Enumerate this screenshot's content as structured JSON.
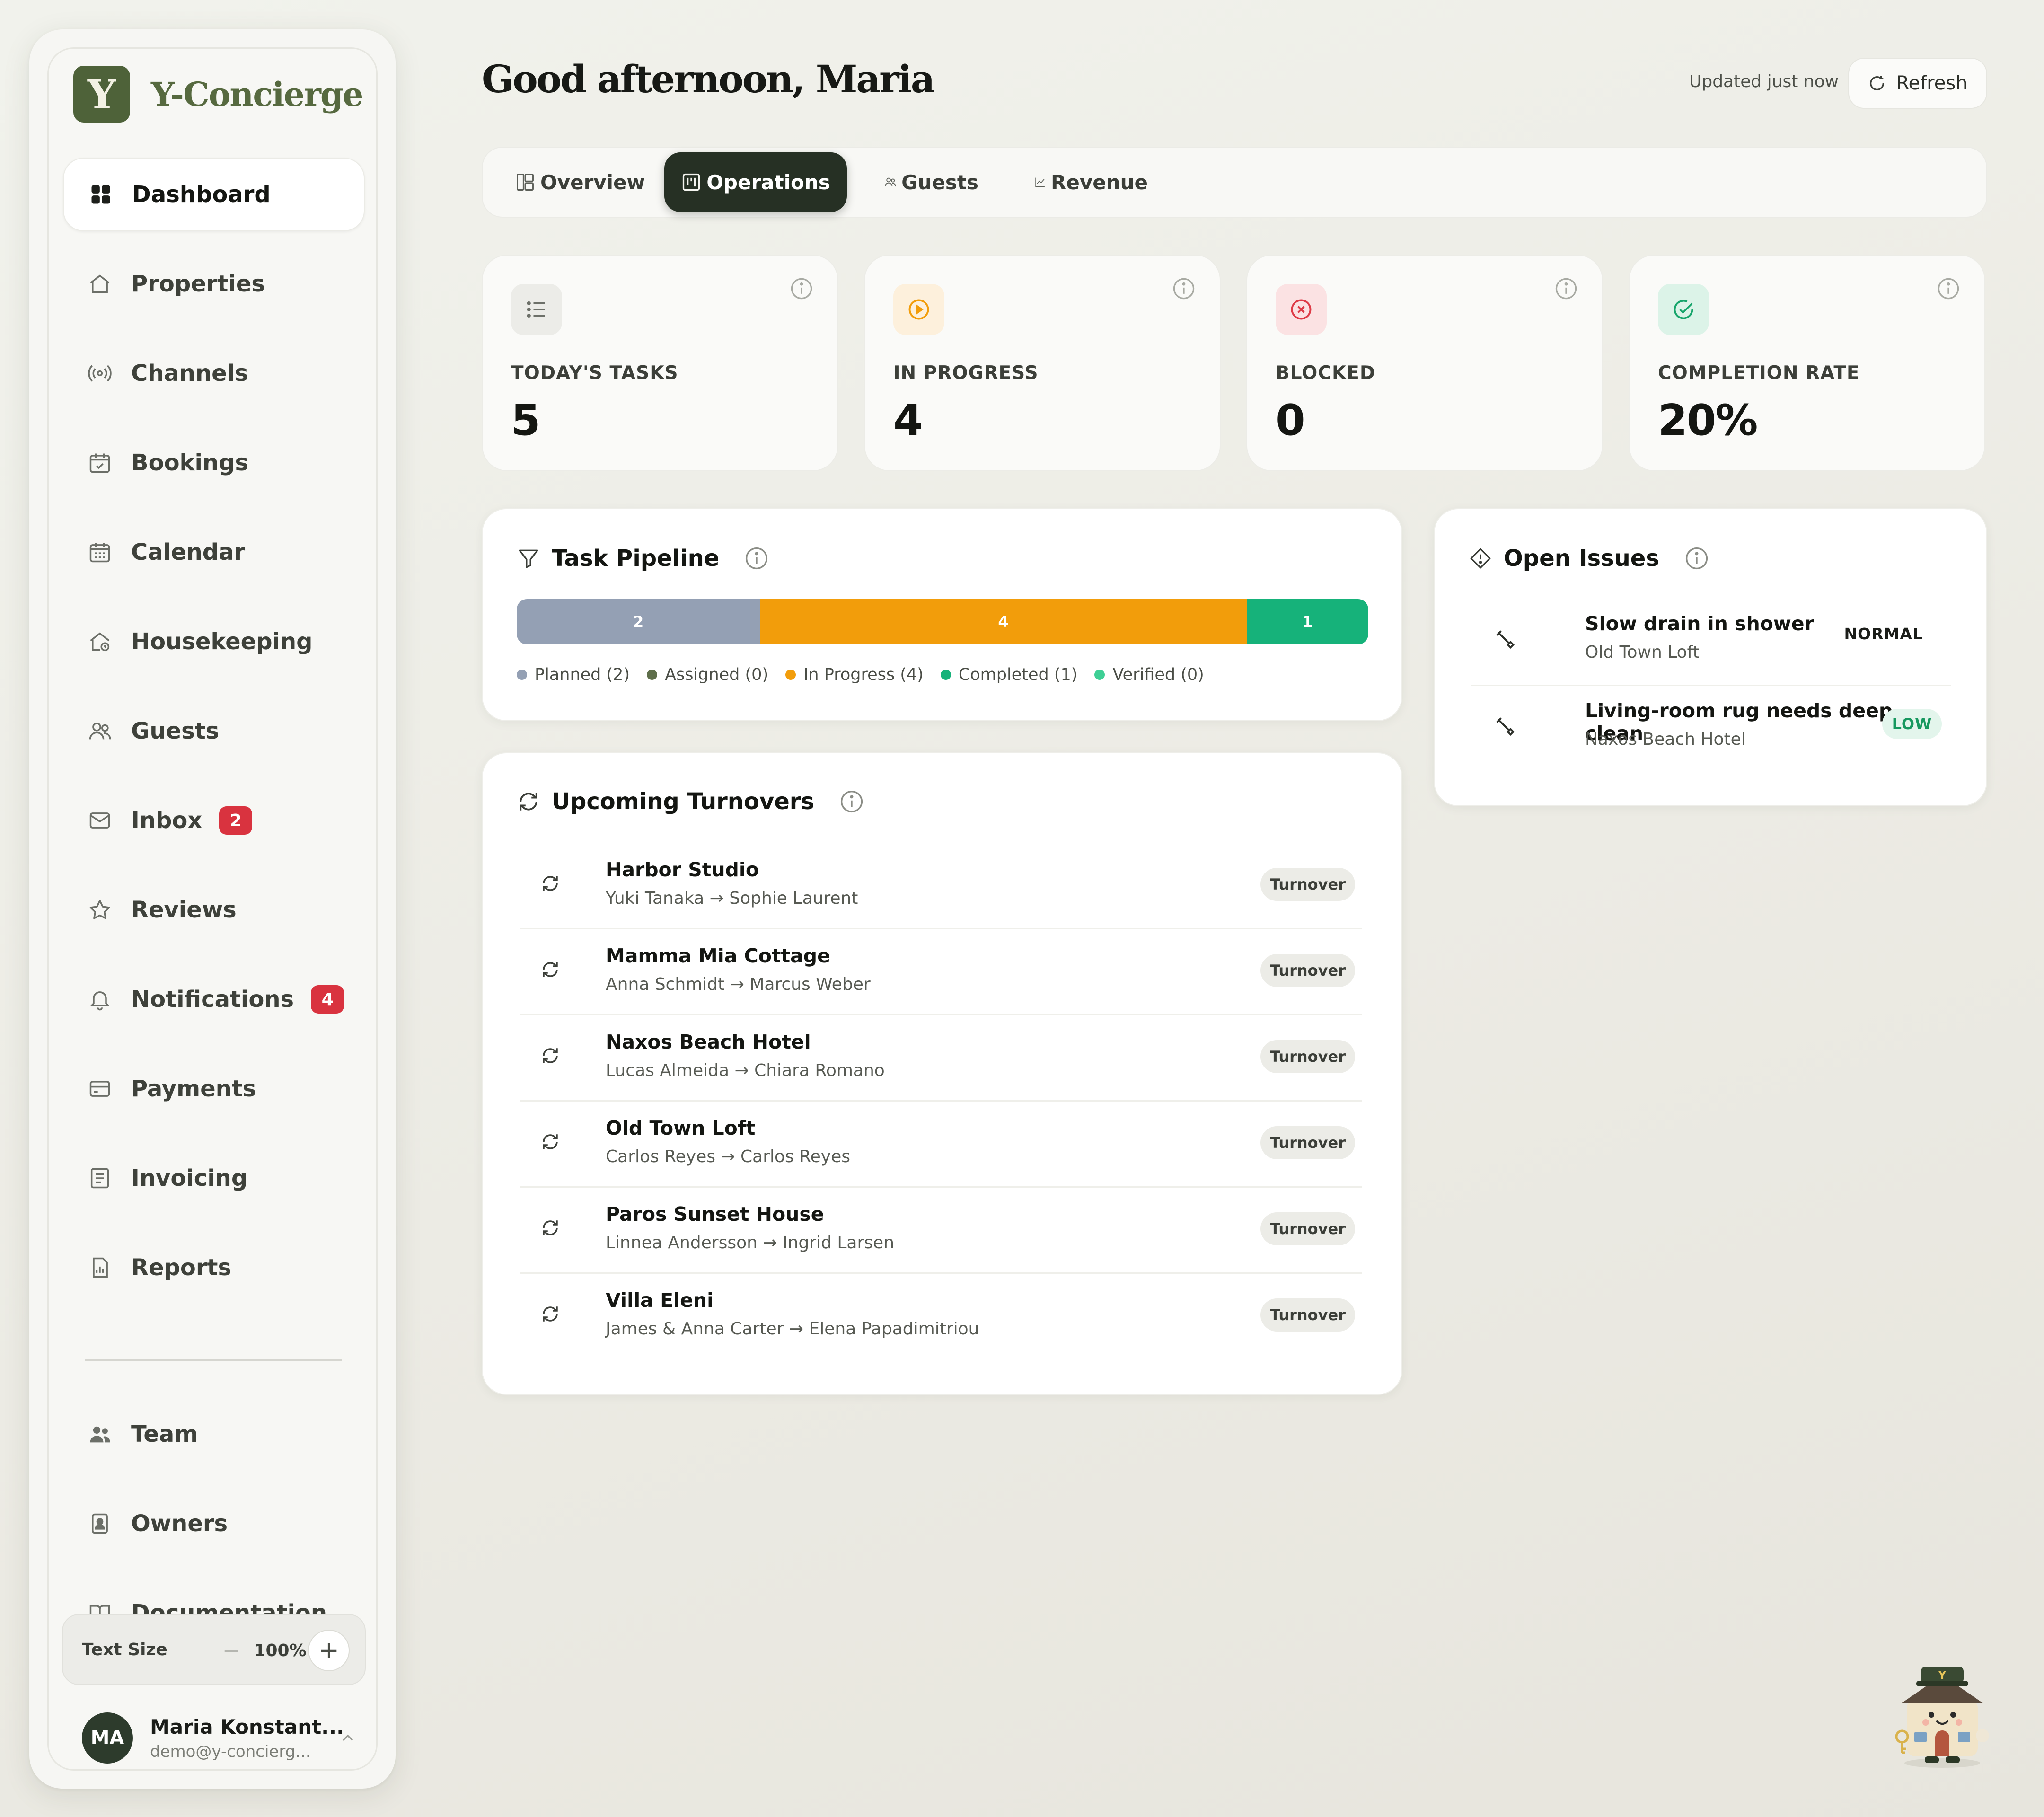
{
  "brand": {
    "logo_letter": "Y",
    "name": "Y-Concierge",
    "color": "#56693f"
  },
  "sidebar": {
    "items": [
      {
        "label": "Dashboard",
        "icon": "dashboard-icon",
        "active": true
      },
      {
        "label": "Properties",
        "icon": "home-icon"
      },
      {
        "label": "Channels",
        "icon": "broadcast-icon"
      },
      {
        "label": "Bookings",
        "icon": "calendar-check-icon"
      },
      {
        "label": "Calendar",
        "icon": "calendar-icon"
      },
      {
        "label": "Housekeeping",
        "icon": "house-clean-icon"
      },
      {
        "label": "Guests",
        "icon": "users-icon"
      },
      {
        "label": "Inbox",
        "icon": "mail-icon",
        "badge": "2"
      },
      {
        "label": "Reviews",
        "icon": "star-icon"
      },
      {
        "label": "Notifications",
        "icon": "bell-icon",
        "badge": "4"
      },
      {
        "label": "Payments",
        "icon": "credit-card-icon"
      },
      {
        "label": "Invoicing",
        "icon": "receipt-icon"
      },
      {
        "label": "Reports",
        "icon": "report-icon"
      }
    ],
    "secondary": [
      {
        "label": "Team",
        "icon": "team-icon"
      },
      {
        "label": "Owners",
        "icon": "owner-badge-icon"
      },
      {
        "label": "Documentation",
        "icon": "book-icon"
      }
    ],
    "text_size": {
      "label": "Text Size",
      "minus": "−",
      "value": "100%",
      "plus": "+"
    },
    "profile": {
      "initials": "MA",
      "name": "Maria Konstant...",
      "email": "demo@y-concierg..."
    }
  },
  "header": {
    "greeting": "Good afternoon, Maria",
    "updated": "Updated just now",
    "refresh_label": "Refresh"
  },
  "tabs": [
    {
      "label": "Overview",
      "icon": "layout-icon"
    },
    {
      "label": "Operations",
      "icon": "kanban-icon",
      "active": true
    },
    {
      "label": "Guests",
      "icon": "users-icon"
    },
    {
      "label": "Revenue",
      "icon": "line-chart-icon"
    }
  ],
  "stats": [
    {
      "label": "TODAY'S TASKS",
      "value": "5",
      "icon": "list-icon",
      "color": "#6d7069"
    },
    {
      "label": "IN PROGRESS",
      "value": "4",
      "icon": "play-circle-icon",
      "color": "#f29d0b"
    },
    {
      "label": "BLOCKED",
      "value": "0",
      "icon": "x-circle-icon",
      "color": "#de3b47"
    },
    {
      "label": "COMPLETION RATE",
      "value": "20%",
      "icon": "check-circle-icon",
      "color": "#17a56b"
    }
  ],
  "pipeline": {
    "title": "Task Pipeline",
    "segments": [
      {
        "label": "2",
        "value": 2,
        "color": "#94a0b4"
      },
      {
        "label": "4",
        "value": 4,
        "color": "#f29d0b"
      },
      {
        "label": "1",
        "value": 1,
        "color": "#16b27a"
      }
    ],
    "legend": [
      {
        "label": "Planned (2)",
        "color": "#94a0b4"
      },
      {
        "label": "Assigned (0)",
        "color": "#5e6e4a"
      },
      {
        "label": "In Progress (4)",
        "color": "#f29d0b"
      },
      {
        "label": "Completed (1)",
        "color": "#16b27a"
      },
      {
        "label": "Verified (0)",
        "color": "#3ecf95"
      }
    ]
  },
  "turnovers": {
    "title": "Upcoming Turnovers",
    "rows": [
      {
        "name": "Harbor Studio",
        "guests": "Yuki Tanaka → Sophie Laurent",
        "badge": "Turnover"
      },
      {
        "name": "Mamma Mia Cottage",
        "guests": "Anna Schmidt → Marcus Weber",
        "badge": "Turnover"
      },
      {
        "name": "Naxos Beach Hotel",
        "guests": "Lucas Almeida → Chiara Romano",
        "badge": "Turnover"
      },
      {
        "name": "Old Town Loft",
        "guests": "Carlos Reyes → Carlos Reyes",
        "badge": "Turnover"
      },
      {
        "name": "Paros Sunset House",
        "guests": "Linnea Andersson → Ingrid Larsen",
        "badge": "Turnover"
      },
      {
        "name": "Villa Eleni",
        "guests": "James & Anna Carter → Elena Papadimitriou",
        "badge": "Turnover"
      }
    ]
  },
  "issues": {
    "title": "Open Issues",
    "rows": [
      {
        "title": "Slow drain in shower",
        "property": "Old Town Loft",
        "priority": "NORMAL"
      },
      {
        "title": "Living-room rug needs deep clean",
        "property": "Naxos Beach Hotel",
        "priority": "LOW"
      }
    ]
  },
  "mascot": {
    "letter": "Y"
  }
}
